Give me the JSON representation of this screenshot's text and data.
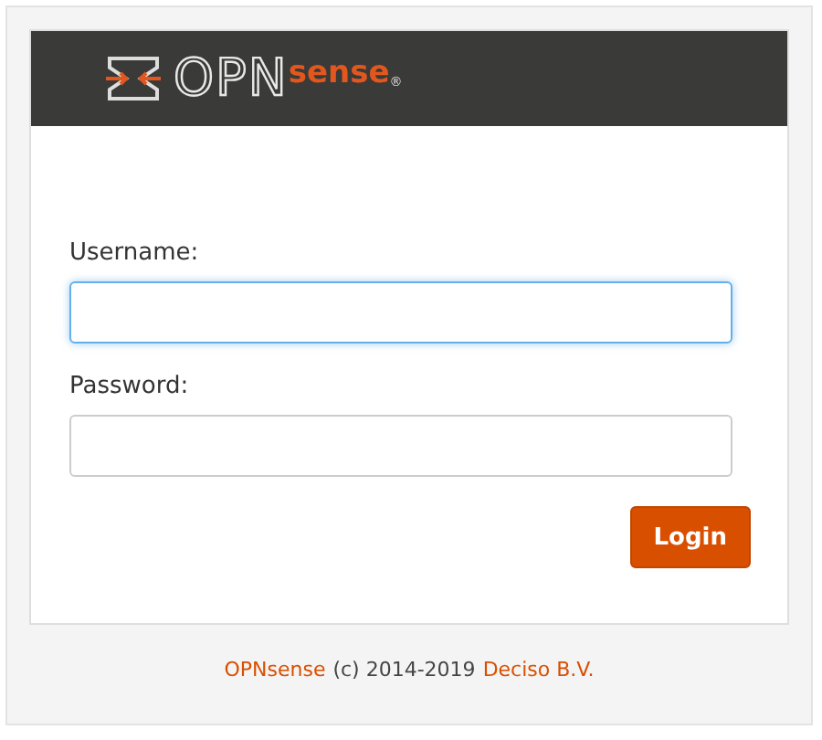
{
  "logo": {
    "prefix": "OPN",
    "suffix": "sense",
    "mark": "®"
  },
  "fields": [
    {
      "label": "Username:",
      "focused": true
    },
    {
      "label": "Password:",
      "focused": false
    }
  ],
  "button": "Login",
  "footer": {
    "product_link": "OPNsense",
    "copyright": "(c) 2014-2019",
    "company_link": "Deciso B.V."
  }
}
